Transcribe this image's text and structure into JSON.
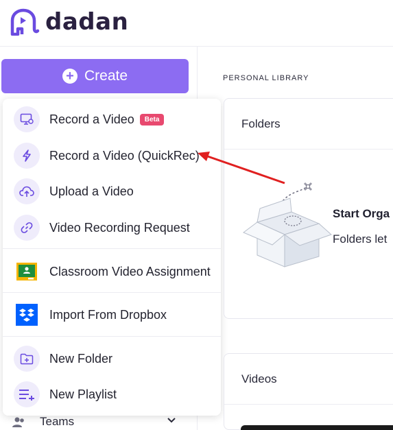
{
  "brand": {
    "name": "dadan",
    "accent": "#8c6cf2",
    "logo_icon": "elephant-icon"
  },
  "sidebar": {
    "create_label": "Create",
    "create_icon": "plus-circle-icon",
    "teams_label": "Teams"
  },
  "menu": {
    "items": [
      {
        "label": "Record a Video",
        "icon": "monitor-record-icon",
        "badge": "Beta"
      },
      {
        "label": "Record a Video (QuickRec)",
        "icon": "lightning-icon"
      },
      {
        "label": "Upload a Video",
        "icon": "cloud-upload-icon"
      },
      {
        "label": "Video Recording Request",
        "icon": "link-icon"
      },
      {
        "label": "Classroom Video Assignment",
        "icon": "google-classroom-icon"
      },
      {
        "label": "Import From Dropbox",
        "icon": "dropbox-icon"
      },
      {
        "label": "New Folder",
        "icon": "folder-plus-icon"
      },
      {
        "label": "New Playlist",
        "icon": "playlist-add-icon"
      }
    ]
  },
  "main": {
    "library_title": "PERSONAL LIBRARY",
    "folders": {
      "title": "Folders",
      "empty_title": "Start Orga",
      "empty_sub": "Folders let"
    },
    "videos": {
      "title": "Videos"
    }
  },
  "annotation": {
    "color": "#e02020",
    "points_to": "Record a Video (QuickRec)"
  }
}
